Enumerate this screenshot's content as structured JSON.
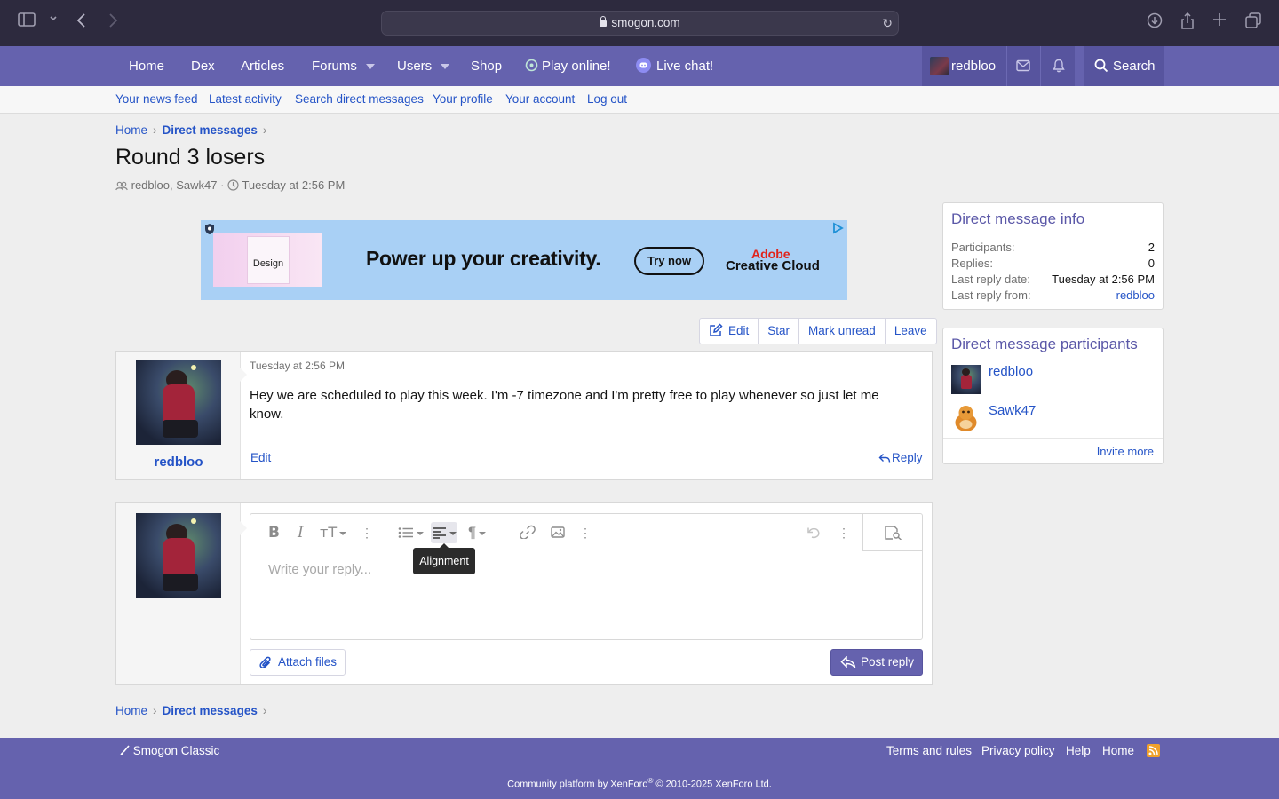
{
  "browser": {
    "url": "smogon.com"
  },
  "nav": {
    "items": [
      {
        "label": "Home"
      },
      {
        "label": "Dex"
      },
      {
        "label": "Articles"
      },
      {
        "label": "Forums"
      },
      {
        "label": "Users"
      },
      {
        "label": "Shop"
      },
      {
        "label": "Play online!"
      },
      {
        "label": "Live chat!"
      }
    ],
    "username": "redbloo",
    "search_label": "Search"
  },
  "subnav": {
    "items": [
      "Your news feed",
      "Latest activity",
      "Search direct messages",
      "Your profile",
      "Your account",
      "Log out"
    ]
  },
  "breadcrumb": {
    "home": "Home",
    "section": "Direct messages"
  },
  "conversation": {
    "title": "Round 3 losers",
    "participants_text": "redbloo, Sawk47",
    "separator": "·",
    "date": "Tuesday at 2:56 PM"
  },
  "ad": {
    "thumb_label": "Design",
    "headline": "Power up your creativity.",
    "cta": "Try now",
    "brand_line1": "Adobe",
    "brand_line2": "Creative Cloud"
  },
  "actions": {
    "edit": "Edit",
    "star": "Star",
    "mark_unread": "Mark unread",
    "leave": "Leave"
  },
  "message": {
    "author": "redbloo",
    "date": "Tuesday at 2:56 PM",
    "body": "Hey we are scheduled to play this week. I'm -7 timezone and I'm pretty free to play whenever so just let me know.",
    "edit_label": "Edit",
    "reply_label": "Reply"
  },
  "editor": {
    "placeholder": "Write your reply...",
    "tooltip": "Alignment",
    "attach_label": "Attach files",
    "post_label": "Post reply"
  },
  "sidebar": {
    "info": {
      "title": "Direct message info",
      "rows": [
        {
          "key": "Participants:",
          "value": "2"
        },
        {
          "key": "Replies:",
          "value": "0"
        },
        {
          "key": "Last reply date:",
          "value": "Tuesday at 2:56 PM"
        },
        {
          "key": "Last reply from:",
          "value": "redbloo"
        }
      ]
    },
    "participants": {
      "title": "Direct message participants",
      "users": [
        "redbloo",
        "Sawk47"
      ],
      "invite_label": "Invite more"
    }
  },
  "footer": {
    "style": "Smogon Classic",
    "links": [
      "Terms and rules",
      "Privacy policy",
      "Help",
      "Home"
    ],
    "copyright_pre": "Community platform by XenForo",
    "copyright_sup": "®",
    "copyright_post": " © 2010-2025 XenForo Ltd."
  },
  "colors": {
    "accent": "#6562ae",
    "link": "#2554c7",
    "chrome": "#2d2a3e"
  }
}
